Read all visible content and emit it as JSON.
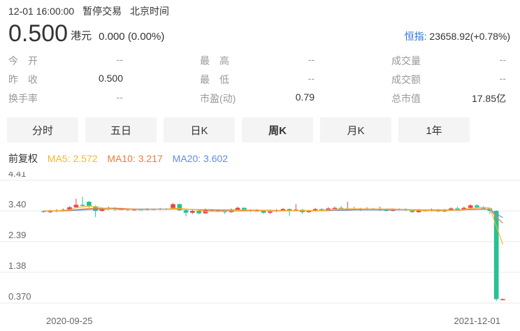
{
  "status": {
    "datetime": "12-01 16:00:00",
    "state": "暂停交易",
    "timezone": "北京时间"
  },
  "quote": {
    "price": "0.500",
    "currency": "港元",
    "change": "0.000 (0.00%)"
  },
  "index": {
    "name": "恒指:",
    "value": "23658.92(+0.78%)"
  },
  "stats": [
    [
      {
        "label": "今　开",
        "value": "--"
      },
      {
        "label": "最　高",
        "value": "--"
      },
      {
        "label": "成交量",
        "value": "--"
      }
    ],
    [
      {
        "label": "昨　收",
        "value": "0.500"
      },
      {
        "label": "最　低",
        "value": "--"
      },
      {
        "label": "成交额",
        "value": "--"
      }
    ],
    [
      {
        "label": "换手率",
        "value": "--"
      },
      {
        "label": "市盈(动)",
        "value": "0.79"
      },
      {
        "label": "总市值",
        "value": "17.85亿"
      }
    ]
  ],
  "tabs": [
    {
      "label": "分时",
      "active": false
    },
    {
      "label": "五日",
      "active": false
    },
    {
      "label": "日K",
      "active": false
    },
    {
      "label": "周K",
      "active": true
    },
    {
      "label": "月K",
      "active": false
    },
    {
      "label": "1年",
      "active": false
    }
  ],
  "ma": {
    "adj_label": "前复权",
    "ma5": {
      "label": "MA5: 2.572",
      "color": "#f5b72c"
    },
    "ma10": {
      "label": "MA10: 3.217",
      "color": "#f07a3a"
    },
    "ma20": {
      "label": "MA20: 3.602",
      "color": "#5b8def"
    }
  },
  "colors": {
    "up": "#e64545",
    "down": "#27c193",
    "grid": "#e8e8e8",
    "axis_text": "#666666"
  },
  "chart_data": {
    "type": "candlestick",
    "y_ticks": [
      "4.41",
      "3.40",
      "2.39",
      "1.38",
      "0.370"
    ],
    "ylim": [
      0.37,
      4.41
    ],
    "x_labels": [
      "2020-09-25",
      "2021-12-01"
    ],
    "candles": [
      [
        3.4,
        3.38,
        3.42,
        3.34
      ],
      [
        3.36,
        3.4,
        3.44,
        3.33
      ],
      [
        3.4,
        3.42,
        3.46,
        3.36
      ],
      [
        3.42,
        3.44,
        3.48,
        3.38
      ],
      [
        3.44,
        3.52,
        3.56,
        3.4
      ],
      [
        3.52,
        3.6,
        3.8,
        3.5
      ],
      [
        3.6,
        3.58,
        3.86,
        3.54
      ],
      [
        3.7,
        3.55,
        3.72,
        3.5
      ],
      [
        3.55,
        3.4,
        3.58,
        3.2
      ],
      [
        3.4,
        3.45,
        3.5,
        3.38
      ],
      [
        3.45,
        3.48,
        3.54,
        3.42
      ],
      [
        3.48,
        3.44,
        3.52,
        3.4
      ],
      [
        3.44,
        3.46,
        3.5,
        3.42
      ],
      [
        3.46,
        3.43,
        3.48,
        3.4
      ],
      [
        3.43,
        3.45,
        3.48,
        3.41
      ],
      [
        3.45,
        3.44,
        3.47,
        3.42
      ],
      [
        3.44,
        3.46,
        3.49,
        3.42
      ],
      [
        3.46,
        3.44,
        3.48,
        3.42
      ],
      [
        3.44,
        3.47,
        3.5,
        3.42
      ],
      [
        3.47,
        3.45,
        3.49,
        3.43
      ],
      [
        3.45,
        3.62,
        3.66,
        3.44
      ],
      [
        3.62,
        3.42,
        3.64,
        3.4
      ],
      [
        3.42,
        3.34,
        3.44,
        3.22
      ],
      [
        3.34,
        3.4,
        3.44,
        3.3
      ],
      [
        3.4,
        3.32,
        3.42,
        3.28
      ],
      [
        3.32,
        3.44,
        3.48,
        3.3
      ],
      [
        3.44,
        3.42,
        3.46,
        3.38
      ],
      [
        3.42,
        3.4,
        3.46,
        3.36
      ],
      [
        3.4,
        3.36,
        3.42,
        3.3
      ],
      [
        3.36,
        3.44,
        3.48,
        3.34
      ],
      [
        3.44,
        3.5,
        3.54,
        3.42
      ],
      [
        3.5,
        3.44,
        3.52,
        3.4
      ],
      [
        3.44,
        3.4,
        3.46,
        3.36
      ],
      [
        3.4,
        3.42,
        3.46,
        3.38
      ],
      [
        3.42,
        3.34,
        3.44,
        3.3
      ],
      [
        3.34,
        3.38,
        3.42,
        3.3
      ],
      [
        3.38,
        3.42,
        3.46,
        3.36
      ],
      [
        3.42,
        3.46,
        3.5,
        3.4
      ],
      [
        3.46,
        3.4,
        3.48,
        3.24
      ],
      [
        3.4,
        3.44,
        3.62,
        3.38
      ],
      [
        3.44,
        3.36,
        3.46,
        3.3
      ],
      [
        3.36,
        3.4,
        3.44,
        3.34
      ],
      [
        3.4,
        3.46,
        3.5,
        3.38
      ],
      [
        3.46,
        3.42,
        3.48,
        3.4
      ],
      [
        3.42,
        3.48,
        3.52,
        3.4
      ],
      [
        3.48,
        3.5,
        3.54,
        3.46
      ],
      [
        3.5,
        3.46,
        3.56,
        3.44
      ],
      [
        3.46,
        3.48,
        3.7,
        3.44
      ],
      [
        3.48,
        3.44,
        3.54,
        3.42
      ],
      [
        3.44,
        3.46,
        3.5,
        3.4
      ],
      [
        3.46,
        3.48,
        3.52,
        3.44
      ],
      [
        3.48,
        3.44,
        3.5,
        3.42
      ],
      [
        3.44,
        3.46,
        3.54,
        3.4
      ],
      [
        3.46,
        3.4,
        3.48,
        3.38
      ],
      [
        3.4,
        3.44,
        3.48,
        3.38
      ],
      [
        3.44,
        3.46,
        3.48,
        3.42
      ],
      [
        3.46,
        3.42,
        3.48,
        3.4
      ],
      [
        3.42,
        3.36,
        3.44,
        3.34
      ],
      [
        3.36,
        3.42,
        3.46,
        3.34
      ],
      [
        3.42,
        3.4,
        3.44,
        3.38
      ],
      [
        3.4,
        3.44,
        3.48,
        3.38
      ],
      [
        3.44,
        3.38,
        3.46,
        3.36
      ],
      [
        3.38,
        3.42,
        3.46,
        3.36
      ],
      [
        3.42,
        3.48,
        3.52,
        3.4
      ],
      [
        3.48,
        3.44,
        3.54,
        3.42
      ],
      [
        3.44,
        3.5,
        3.54,
        3.42
      ],
      [
        3.5,
        3.58,
        3.62,
        3.48
      ],
      [
        3.58,
        3.52,
        3.62,
        3.5
      ],
      [
        3.52,
        3.48,
        3.56,
        3.46
      ],
      [
        3.48,
        3.4,
        3.5,
        3.3
      ],
      [
        3.4,
        0.5,
        3.42,
        0.44
      ],
      [
        0.5,
        0.5,
        0.52,
        0.48
      ]
    ],
    "ma5": [
      3.4,
      3.4,
      3.41,
      3.42,
      3.44,
      3.5,
      3.53,
      3.56,
      3.53,
      3.5,
      3.47,
      3.45,
      3.44,
      3.45,
      3.45,
      3.44,
      3.45,
      3.45,
      3.45,
      3.45,
      3.49,
      3.48,
      3.46,
      3.45,
      3.42,
      3.38,
      3.38,
      3.38,
      3.39,
      3.41,
      3.42,
      3.43,
      3.43,
      3.43,
      3.42,
      3.4,
      3.39,
      3.4,
      3.4,
      3.41,
      3.42,
      3.41,
      3.41,
      3.42,
      3.43,
      3.45,
      3.47,
      3.47,
      3.47,
      3.47,
      3.46,
      3.46,
      3.46,
      3.45,
      3.44,
      3.44,
      3.44,
      3.42,
      3.42,
      3.41,
      3.41,
      3.4,
      3.41,
      3.42,
      3.43,
      3.45,
      3.48,
      3.5,
      3.51,
      3.5,
      2.9,
      2.3
    ],
    "ma10": [
      3.4,
      3.4,
      3.4,
      3.41,
      3.42,
      3.44,
      3.46,
      3.48,
      3.48,
      3.48,
      3.49,
      3.49,
      3.48,
      3.47,
      3.46,
      3.45,
      3.45,
      3.45,
      3.45,
      3.45,
      3.46,
      3.46,
      3.46,
      3.45,
      3.44,
      3.43,
      3.42,
      3.42,
      3.41,
      3.4,
      3.4,
      3.4,
      3.41,
      3.41,
      3.41,
      3.41,
      3.41,
      3.41,
      3.41,
      3.41,
      3.41,
      3.4,
      3.4,
      3.41,
      3.42,
      3.43,
      3.44,
      3.44,
      3.45,
      3.45,
      3.46,
      3.46,
      3.46,
      3.46,
      3.46,
      3.45,
      3.45,
      3.44,
      3.44,
      3.43,
      3.43,
      3.42,
      3.42,
      3.42,
      3.42,
      3.43,
      3.45,
      3.46,
      3.46,
      3.46,
      3.2,
      3.0
    ],
    "ma20": [
      3.4,
      3.4,
      3.4,
      3.4,
      3.41,
      3.42,
      3.43,
      3.44,
      3.45,
      3.45,
      3.46,
      3.46,
      3.46,
      3.46,
      3.46,
      3.46,
      3.46,
      3.46,
      3.46,
      3.46,
      3.46,
      3.46,
      3.45,
      3.45,
      3.44,
      3.44,
      3.44,
      3.43,
      3.43,
      3.43,
      3.43,
      3.43,
      3.42,
      3.42,
      3.42,
      3.42,
      3.41,
      3.41,
      3.41,
      3.41,
      3.41,
      3.41,
      3.41,
      3.41,
      3.41,
      3.42,
      3.42,
      3.42,
      3.43,
      3.43,
      3.43,
      3.43,
      3.43,
      3.43,
      3.43,
      3.43,
      3.43,
      3.43,
      3.43,
      3.43,
      3.43,
      3.43,
      3.43,
      3.43,
      3.43,
      3.44,
      3.44,
      3.45,
      3.45,
      3.45,
      3.3,
      3.18
    ]
  }
}
